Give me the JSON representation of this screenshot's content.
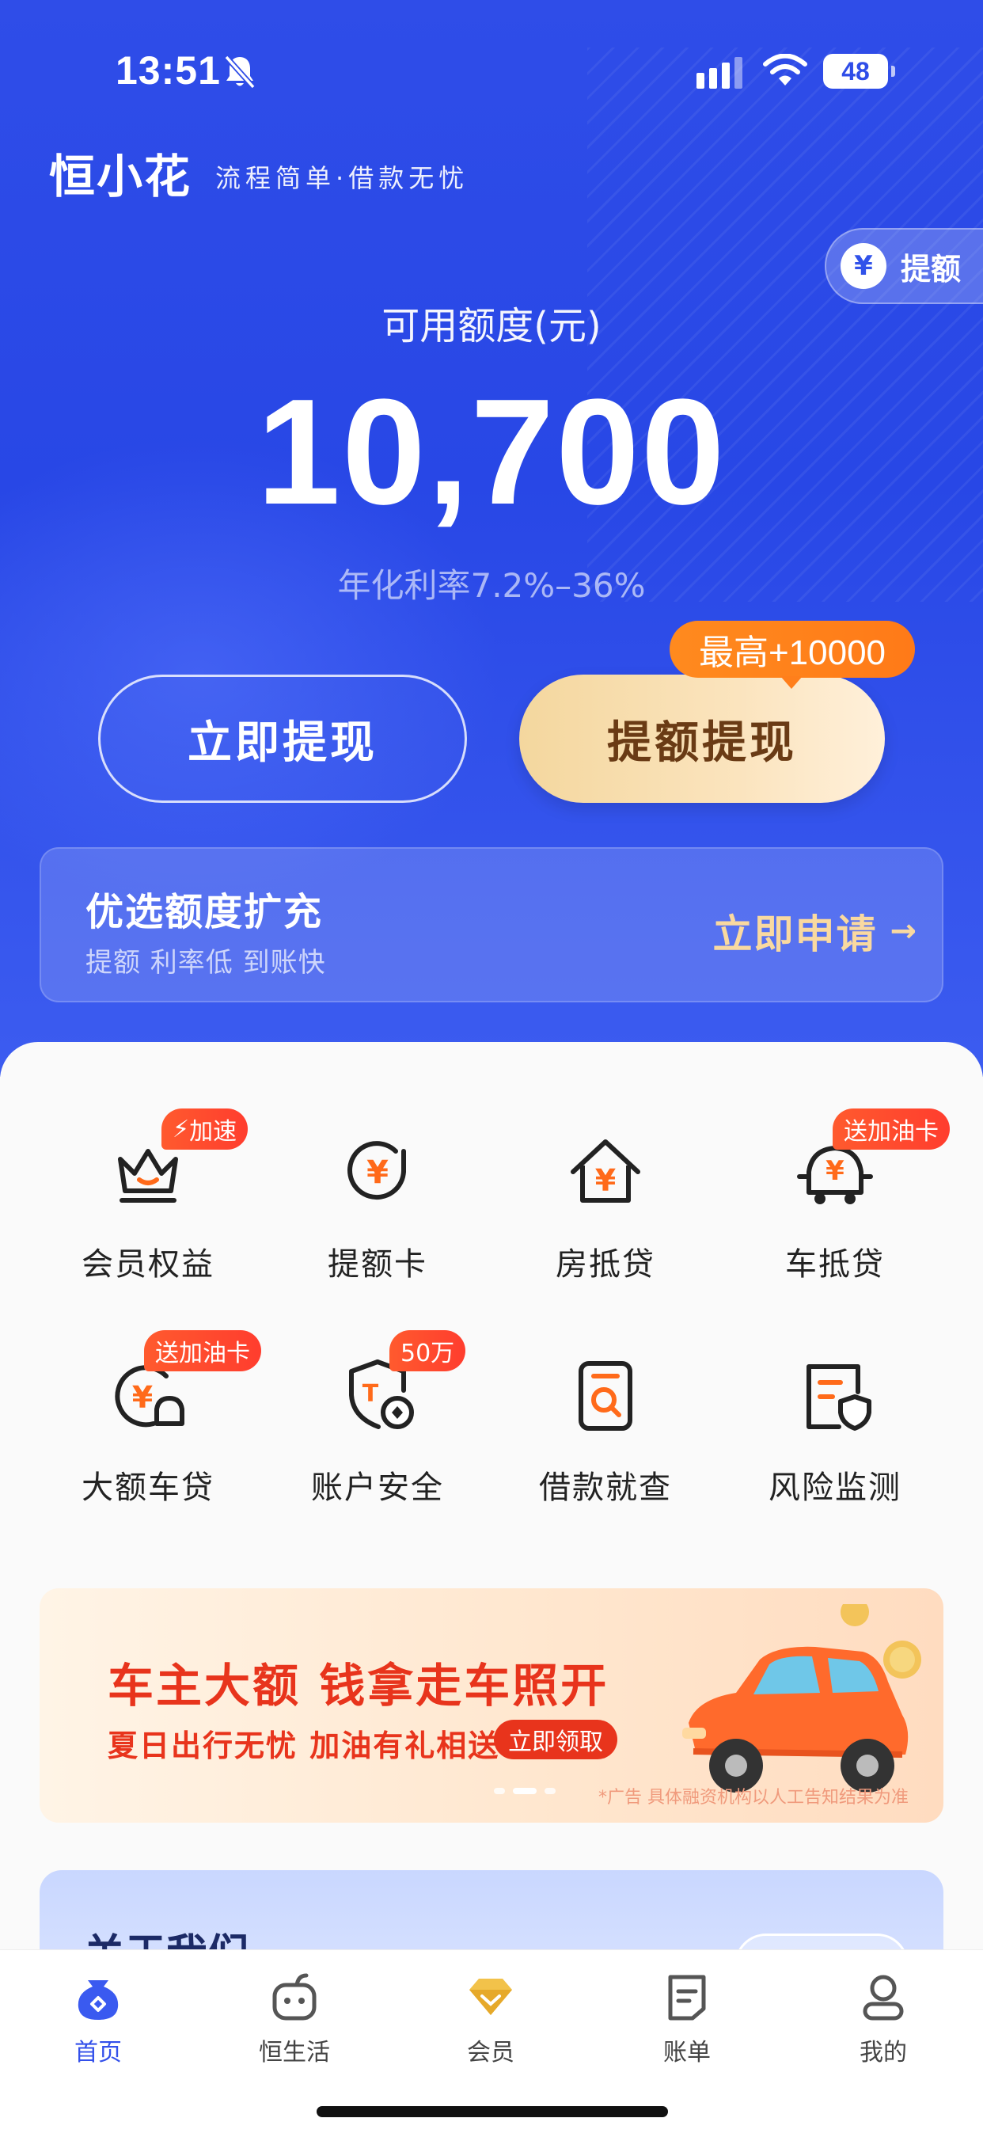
{
  "status_bar": {
    "time": "13:51",
    "battery": "48"
  },
  "brand": {
    "logo": "恒小花",
    "slogan": "流程简单·借款无忧"
  },
  "raise_quota": {
    "label": "提额",
    "icon": "yen-icon"
  },
  "quota": {
    "label": "可用额度(元)",
    "amount": "10,700",
    "rate": "年化利率7.2%–36%"
  },
  "buttons": {
    "withdraw": "立即提现",
    "raise_withdraw": "提额提现",
    "max_tag": "最高+10000"
  },
  "promo": {
    "title": "优选额度扩充",
    "subtitle": "提额 利率低 到账快",
    "apply": "立即申请",
    "arrow": "→"
  },
  "services": [
    {
      "label": "会员权益",
      "icon": "crown-icon",
      "badge": "加速"
    },
    {
      "label": "提额卡",
      "icon": "yen-refresh-icon",
      "badge": ""
    },
    {
      "label": "房抵贷",
      "icon": "house-yen-icon",
      "badge": ""
    },
    {
      "label": "车抵贷",
      "icon": "car-yen-icon",
      "badge": "送加油卡"
    },
    {
      "label": "大额车贷",
      "icon": "yen-car-coin-icon",
      "badge": "送加油卡"
    },
    {
      "label": "账户安全",
      "icon": "shield-coin-icon",
      "badge": "50万"
    },
    {
      "label": "借款就查",
      "icon": "document-search-icon",
      "badge": ""
    },
    {
      "label": "风险监测",
      "icon": "document-shield-icon",
      "badge": ""
    }
  ],
  "banner": {
    "title": "车主大额  钱拿走车照开",
    "subtitle": "夏日出行无忧 加油有礼相送",
    "claim": "立即领取",
    "disclaimer": "*广告 具体融资机构以人工告知结果为准"
  },
  "about": {
    "title": "关于我们"
  },
  "tabs": [
    {
      "label": "首页",
      "icon": "home-icon",
      "active": true
    },
    {
      "label": "恒生活",
      "icon": "life-icon",
      "active": false
    },
    {
      "label": "会员",
      "icon": "diamond-icon",
      "active": false
    },
    {
      "label": "账单",
      "icon": "bill-icon",
      "active": false
    },
    {
      "label": "我的",
      "icon": "profile-icon",
      "active": false
    }
  ],
  "colors": {
    "primary_blue": "#2f4de8",
    "accent_orange": "#ff7a18",
    "badge_red": "#ff4a2e",
    "gold": "#f9d9a0",
    "banner_red": "#e8341c"
  }
}
